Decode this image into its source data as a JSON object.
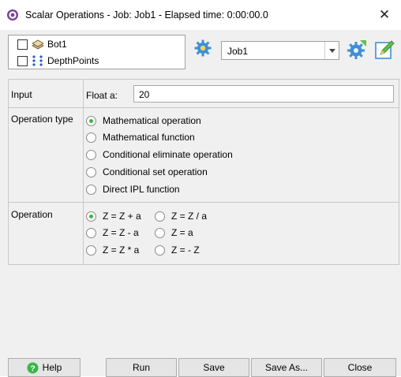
{
  "window": {
    "title": "Scalar Operations - Job: Job1 - Elapsed time: 0:00:00.0",
    "close_glyph": "✕"
  },
  "layers": [
    {
      "label": "Bot1",
      "checked": false,
      "icon": "surface-layer-icon"
    },
    {
      "label": "DepthPoints",
      "checked": false,
      "icon": "points-layer-icon"
    }
  ],
  "job": {
    "selected": "Job1"
  },
  "form": {
    "input": {
      "section_label": "Input",
      "field_label": "Float a:",
      "value": "20"
    },
    "operation_type": {
      "section_label": "Operation type",
      "options": [
        {
          "label": "Mathematical operation",
          "selected": true
        },
        {
          "label": "Mathematical function",
          "selected": false
        },
        {
          "label": "Conditional eliminate operation",
          "selected": false
        },
        {
          "label": "Conditional set operation",
          "selected": false
        },
        {
          "label": "Direct IPL function",
          "selected": false
        }
      ]
    },
    "operation": {
      "section_label": "Operation",
      "options": [
        {
          "label": "Z = Z + a",
          "selected": true
        },
        {
          "label": "Z = Z / a",
          "selected": false
        },
        {
          "label": "Z = Z - a",
          "selected": false
        },
        {
          "label": "Z = a",
          "selected": false
        },
        {
          "label": "Z = Z * a",
          "selected": false
        },
        {
          "label": "Z = - Z",
          "selected": false
        }
      ]
    }
  },
  "buttons": {
    "help": "Help",
    "run": "Run",
    "save": "Save",
    "save_as": "Save As...",
    "close": "Close"
  },
  "colors": {
    "radio_selected": "#3bb54a",
    "dialog_bg": "#f0f0f0",
    "gear": "#3d8fd6",
    "gear_accent": "#5cc241"
  }
}
